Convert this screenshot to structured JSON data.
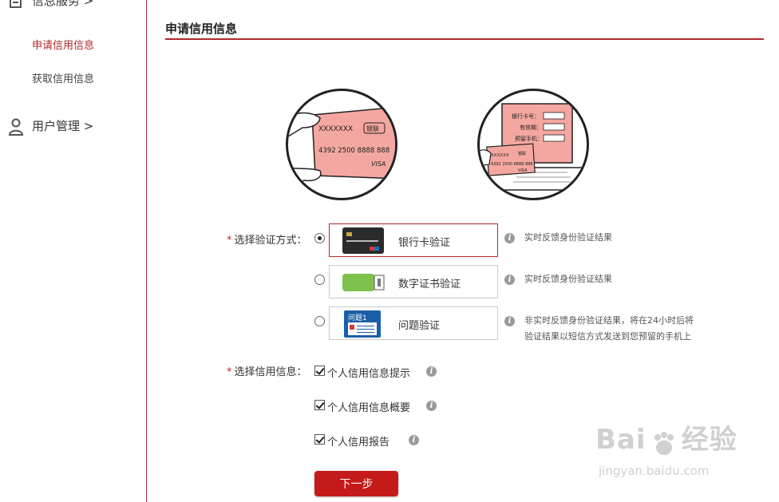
{
  "sidebar": {
    "section_info": {
      "label": "信息服务 >",
      "icon": "document-icon"
    },
    "items": [
      {
        "label": "申请信用信息",
        "active": true
      },
      {
        "label": "获取信用信息",
        "active": false
      }
    ],
    "section_user": {
      "label": "用户管理 >",
      "icon": "user-icon"
    }
  },
  "main": {
    "title": "申请信用信息",
    "illustration_card": {
      "card_name": "XXXXXXX",
      "card_brand": "银联",
      "card_number": "4392 2500 8888 888",
      "card_network": "VISA"
    },
    "illustration_laptop": {
      "fields": [
        "银行卡号：",
        "有效期：",
        "预留手机："
      ],
      "card_name": "XXXXXX",
      "card_brand": "银联",
      "card_number": "4392 2500 8888 888",
      "card_network": "VISA"
    },
    "verify": {
      "label": "选择验证方式：",
      "required_mark": "*",
      "options": [
        {
          "label": "银行卡验证",
          "selected": true,
          "info": "实时反馈身份验证结果",
          "icon": "bank-card-icon"
        },
        {
          "label": "数字证书验证",
          "selected": false,
          "info": "实时反馈身份验证结果",
          "icon": "usb-key-icon"
        },
        {
          "label": "问题验证",
          "selected": false,
          "info_lines": [
            "非实时反馈身份验证结果，将在24小时后将",
            "验证结果以短信方式发送到您预留的手机上"
          ],
          "icon": "question-card-icon",
          "icon_text": "问题1"
        }
      ]
    },
    "credit": {
      "label": "选择信用信息：",
      "required_mark": "*",
      "items": [
        {
          "label": "个人信用信息提示",
          "checked": true
        },
        {
          "label": "个人信用信息概要",
          "checked": true
        },
        {
          "label": "个人信用报告",
          "checked": true
        }
      ]
    },
    "next_button": "下一步"
  },
  "watermark": {
    "main": "Bai",
    "main_suffix": "经验",
    "sub": "jingyan.baidu.com"
  },
  "colors": {
    "accent": "#b02a2a",
    "button": "#c41a1a",
    "card_pink": "#f4a7a0"
  }
}
